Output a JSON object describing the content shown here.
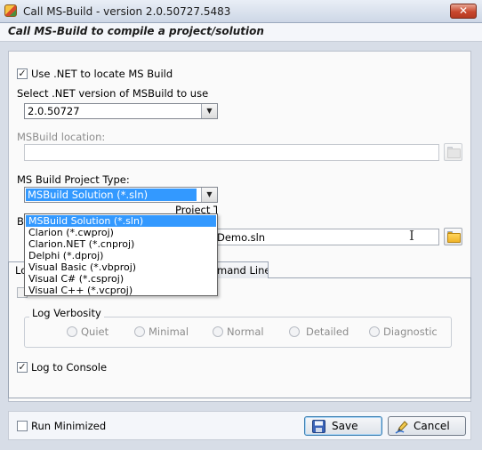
{
  "window": {
    "title": "Call MS-Build - version 2.0.50727.5483",
    "close_glyph": "✕",
    "header": "Call MS-Build to compile a project/solution"
  },
  "dotnet": {
    "use_net_label": "Use .NET to locate MS Build",
    "use_net_checked": true,
    "version_label": "Select .NET version of MSBuild to use",
    "version_value": "2.0.50727"
  },
  "msbuild_location": {
    "label": "MSBuild location:",
    "value": ""
  },
  "project_type": {
    "label": "MS Build Project Type:",
    "selected": "MSBuild Solution (*.sln)",
    "hidden_label_fragment": "Project Ty",
    "options": [
      "MSBuild Solution (*.sln)",
      "Clarion (*.cwproj)",
      "Clarion.NET (*.cnproj)",
      "Delphi (*.dproj)",
      "Visual Basic (*.vbproj)",
      "Visual C# (*.csproj)",
      "Visual C++ (*.vcproj)"
    ]
  },
  "build_file": {
    "label_fragment": "B",
    "value_fragment": "Demo.sln"
  },
  "tabs": {
    "first_fragment": "Lo",
    "second_fragment": "mand Line"
  },
  "log": {
    "verbosity_title": "Log Verbosity",
    "options": [
      "Quiet",
      "Minimal",
      "Normal",
      "Detailed",
      "Diagnostic"
    ],
    "to_console_label": "Log to Console",
    "to_console_checked": true
  },
  "bottom": {
    "run_minimized_label": "Run Minimized",
    "run_minimized_checked": false,
    "save_label": "Save",
    "cancel_label": "Cancel"
  },
  "icons": {
    "check_glyph": "✓",
    "dropdown_arrow": "▼",
    "cursor_glyph": "I",
    "save_icon": "save-icon",
    "cancel_icon": "cancel-pen-icon",
    "folder_icon": "folder-icon"
  },
  "colors": {
    "selection_blue": "#3399ff",
    "folder_yellow": "#f0b429"
  }
}
